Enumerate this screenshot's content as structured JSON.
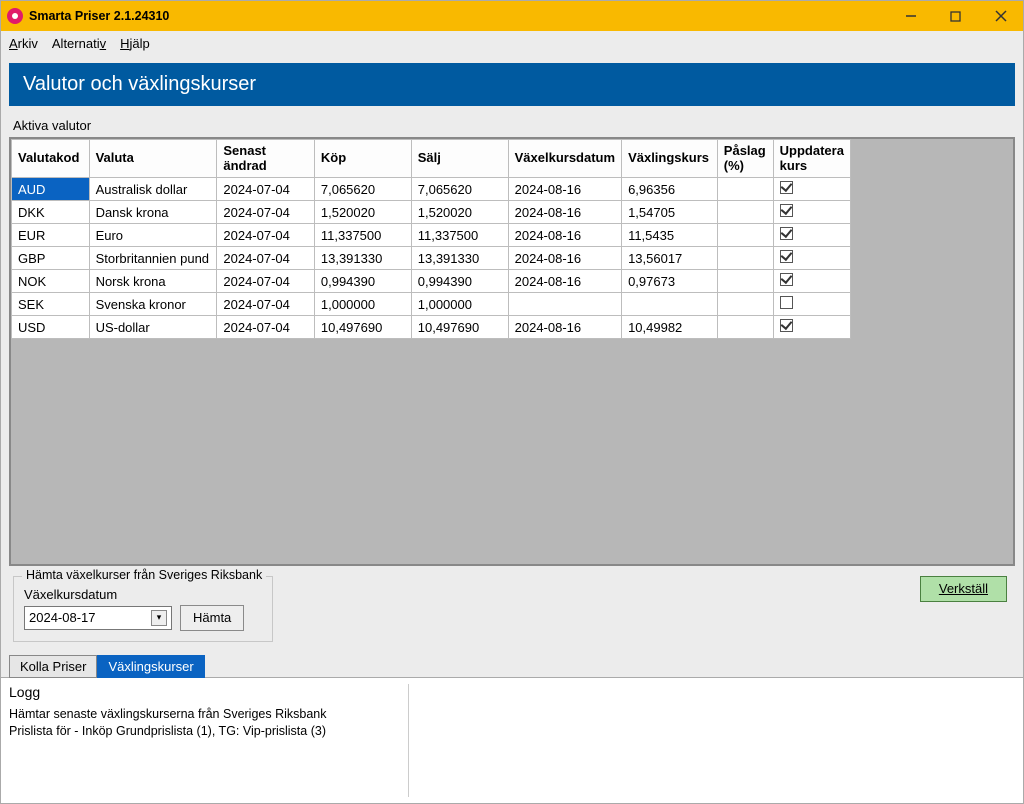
{
  "title": "Smarta Priser 2.1.24310",
  "menu": {
    "arkiv": "Arkiv",
    "alternativ": "Alternativ",
    "hjalp": "Hjälp"
  },
  "section_header": "Valutor och växlingskurser",
  "subhead": "Aktiva valutor",
  "columns": {
    "code": "Valutakod",
    "valuta": "Valuta",
    "senast_l1": "Senast",
    "senast_l2": "ändrad",
    "kop": "Köp",
    "salj": "Sälj",
    "vkdatum": "Växelkursdatum",
    "vkurs": "Växlingskurs",
    "paslag_l1": "Påslag",
    "paslag_l2": "(%)",
    "uppdatera_l1": "Uppdatera",
    "uppdatera_l2": "kurs"
  },
  "rows": [
    {
      "code": "AUD",
      "valuta": "Australisk dollar",
      "senast": "2024-07-04",
      "kop": "7,065620",
      "salj": "7,065620",
      "vkdatum": "2024-08-16",
      "vkurs": "6,96356",
      "paslag": "",
      "upd": true,
      "selected": true
    },
    {
      "code": "DKK",
      "valuta": "Dansk krona",
      "senast": "2024-07-04",
      "kop": "1,520020",
      "salj": "1,520020",
      "vkdatum": "2024-08-16",
      "vkurs": "1,54705",
      "paslag": "",
      "upd": true,
      "selected": false
    },
    {
      "code": "EUR",
      "valuta": "Euro",
      "senast": "2024-07-04",
      "kop": "11,337500",
      "salj": "11,337500",
      "vkdatum": "2024-08-16",
      "vkurs": "11,5435",
      "paslag": "",
      "upd": true,
      "selected": false
    },
    {
      "code": "GBP",
      "valuta": "Storbritannien pund",
      "senast": "2024-07-04",
      "kop": "13,391330",
      "salj": "13,391330",
      "vkdatum": "2024-08-16",
      "vkurs": "13,56017",
      "paslag": "",
      "upd": true,
      "selected": false
    },
    {
      "code": "NOK",
      "valuta": "Norsk krona",
      "senast": "2024-07-04",
      "kop": "0,994390",
      "salj": "0,994390",
      "vkdatum": "2024-08-16",
      "vkurs": "0,97673",
      "paslag": "",
      "upd": true,
      "selected": false
    },
    {
      "code": "SEK",
      "valuta": "Svenska kronor",
      "senast": "2024-07-04",
      "kop": "1,000000",
      "salj": "1,000000",
      "vkdatum": "",
      "vkurs": "",
      "paslag": "",
      "upd": false,
      "selected": false
    },
    {
      "code": "USD",
      "valuta": "US-dollar",
      "senast": "2024-07-04",
      "kop": "10,497690",
      "salj": "10,497690",
      "vkdatum": "2024-08-16",
      "vkurs": "10,49982",
      "paslag": "",
      "upd": true,
      "selected": false
    }
  ],
  "fetch": {
    "legend": "Hämta växelkurser från Sveriges Riksbank",
    "label": "Växelkursdatum",
    "date": "2024-08-17",
    "button": "Hämta"
  },
  "verkstall": "Verkställ",
  "tabs": {
    "kolla": "Kolla Priser",
    "vaxling": "Växlingskurser"
  },
  "log": {
    "title": "Logg",
    "line1": "Hämtar senaste växlingskurserna från Sveriges Riksbank",
    "line2": "Prislista för - Inköp Grundprislista (1), TG: Vip-prislista (3)"
  }
}
